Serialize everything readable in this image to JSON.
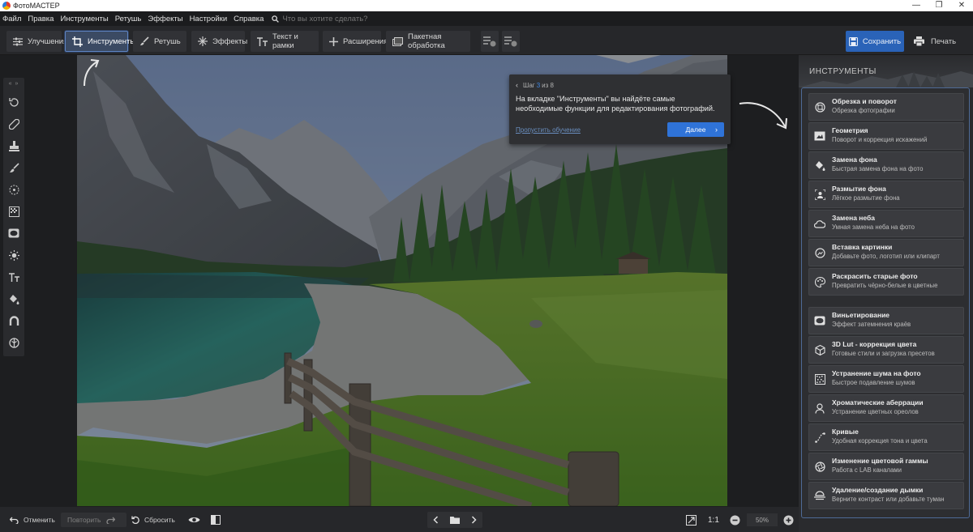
{
  "window": {
    "title": "ФотоМАСТЕР",
    "controls": [
      "—",
      "❐",
      "✕"
    ]
  },
  "menu": {
    "items": [
      "Файл",
      "Правка",
      "Инструменты",
      "Ретушь",
      "Эффекты",
      "Настройки",
      "Справка"
    ],
    "search_placeholder": "Что вы хотите сделать?"
  },
  "toolbar": {
    "tabs": [
      {
        "label": "Улучшения",
        "icon": "sliders-icon"
      },
      {
        "label": "Инструменты",
        "icon": "crop-icon",
        "active": true
      },
      {
        "label": "Ретушь",
        "icon": "brush-icon"
      },
      {
        "label": "Эффекты",
        "icon": "sparkle-icon"
      },
      {
        "label": "Текст и рамки",
        "icon": "text-icon"
      },
      {
        "label": "Расширения",
        "icon": "plus-icon"
      },
      {
        "label": "Пакетная обработка",
        "icon": "batch-icon"
      }
    ],
    "save_label": "Сохранить",
    "print_label": "Печать"
  },
  "tooltip": {
    "step_prefix": "Шаг",
    "step_current": "3",
    "step_suffix": "из 8",
    "text": "На вкладке \"Инструменты\" вы найдёте самые необходимые функции для редактирования фотографий.",
    "skip_label": "Пропустить обучение",
    "next_label": "Далее"
  },
  "panel": {
    "title": "ИНСТРУМЕНТЫ",
    "tools": [
      {
        "title": "Обрезка и поворот",
        "subtitle": "Обрезка фотографии",
        "icon": "crop-rotate-icon"
      },
      {
        "title": "Геометрия",
        "subtitle": "Поворот и коррекция искажений",
        "icon": "geometry-icon"
      },
      {
        "title": "Замена фона",
        "subtitle": "Быстрая замена фона на фото",
        "icon": "bucket-icon"
      },
      {
        "title": "Размытие фона",
        "subtitle": "Лёгкое размытие фона",
        "icon": "blur-bg-icon"
      },
      {
        "title": "Замена неба",
        "subtitle": "Умная замена неба на фото",
        "icon": "cloud-icon"
      },
      {
        "title": "Вставка картинки",
        "subtitle": "Добавьте фото, логотип или клипарт",
        "icon": "insert-image-icon"
      },
      {
        "title": "Раскрасить старые фото",
        "subtitle": "Превратить чёрно-белые в цветные",
        "icon": "palette-icon"
      },
      {
        "title": "Виньетирование",
        "subtitle": "Эффект затемнения краёв",
        "icon": "vignette-icon"
      },
      {
        "title": "3D Lut - коррекция цвета",
        "subtitle": "Готовые стили и загрузка пресетов",
        "icon": "cube-icon"
      },
      {
        "title": "Устранение шума на фото",
        "subtitle": "Быстрое подавление шумов",
        "icon": "noise-icon"
      },
      {
        "title": "Хроматические аберрации",
        "subtitle": "Устранение цветных ореолов",
        "icon": "person-icon"
      },
      {
        "title": "Кривые",
        "subtitle": "Удобная коррекция тона и цвета",
        "icon": "curves-icon"
      },
      {
        "title": "Изменение цветовой гаммы",
        "subtitle": "Работа с LAB каналами",
        "icon": "aperture-icon"
      },
      {
        "title": "Удаление/создание дымки",
        "subtitle": "Верните контраст или добавьте туман",
        "icon": "haze-icon"
      }
    ]
  },
  "bottom": {
    "undo_label": "Отменить",
    "redo_label": "Повторить",
    "reset_label": "Сбросить",
    "zoom_ratio": "1:1",
    "zoom_value": "50%"
  },
  "colors": {
    "accent": "#2f73d8",
    "active_tab_border": "#5f84c2",
    "panel_border": "#4e6a96"
  }
}
